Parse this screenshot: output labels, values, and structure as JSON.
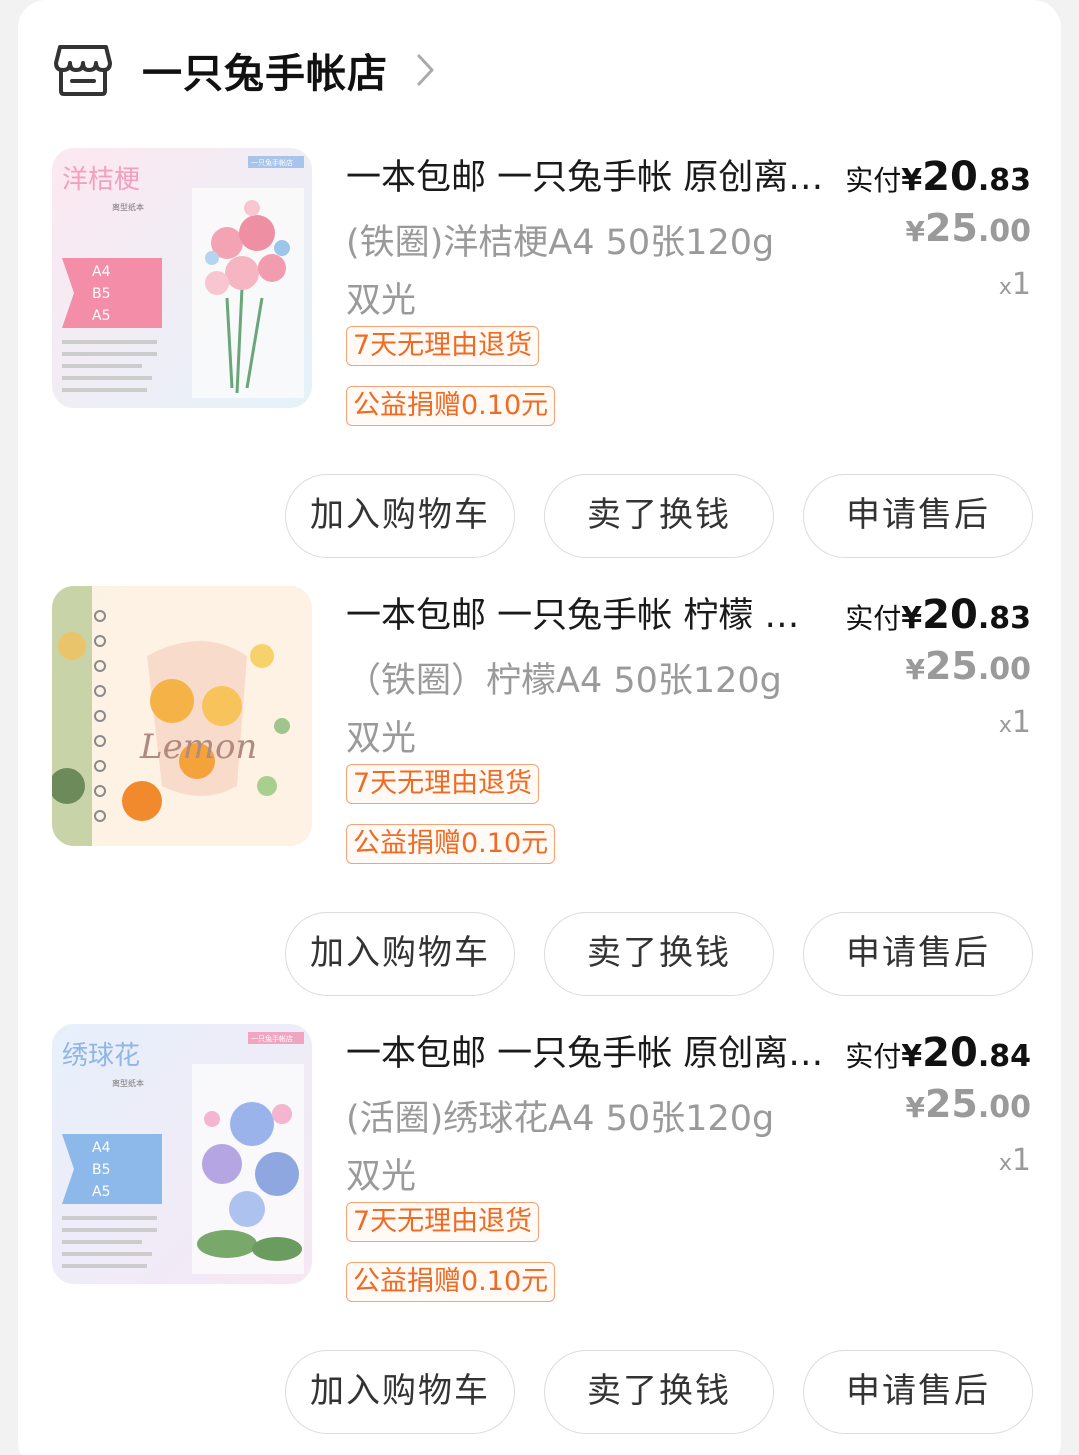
{
  "shop": {
    "name": "一只兔手帐店",
    "icon": "store-icon",
    "chevron": "chevron-right-icon"
  },
  "items": [
    {
      "title": "一本包邮 一只兔手帐 原创离型纸本 洋桔梗",
      "sku": "(铁圈)洋桔梗A4 50张120g 双光",
      "tag_return": "7天无理由退货",
      "tag_charity": "公益捐赠0.10元",
      "paid_label": "实付",
      "paid_currency": "¥",
      "paid_int": "20",
      "paid_dec": ".83",
      "orig_currency": "¥",
      "orig_int": "25",
      "orig_dec": ".00",
      "qty_x": "x",
      "qty_n": "1",
      "thumb_title": "洋桔梗",
      "thumb_sub": "离型纸本",
      "thumb_badge": "一只兔手帐店",
      "buttons": {
        "cart": "加入购物车",
        "sell": "卖了换钱",
        "after": "申请售后"
      }
    },
    {
      "title": "一本包邮 一只兔手帐 柠檬 离型纸本",
      "sku": "（铁圈）柠檬A4 50张120g 双光",
      "tag_return": "7天无理由退货",
      "tag_charity": "公益捐赠0.10元",
      "paid_label": "实付",
      "paid_currency": "¥",
      "paid_int": "20",
      "paid_dec": ".83",
      "orig_currency": "¥",
      "orig_int": "25",
      "orig_dec": ".00",
      "qty_x": "x",
      "qty_n": "1",
      "thumb_title": "Lemon",
      "buttons": {
        "cart": "加入购物车",
        "sell": "卖了换钱",
        "after": "申请售后"
      }
    },
    {
      "title": "一本包邮 一只兔手帐 原创离型纸本 绣球花",
      "sku": "(活圈)绣球花A4 50张120g 双光",
      "tag_return": "7天无理由退货",
      "tag_charity": "公益捐赠0.10元",
      "paid_label": "实付",
      "paid_currency": "¥",
      "paid_int": "20",
      "paid_dec": ".84",
      "orig_currency": "¥",
      "orig_int": "25",
      "orig_dec": ".00",
      "qty_x": "x",
      "qty_n": "1",
      "thumb_title": "绣球花",
      "thumb_sub": "离型纸本",
      "thumb_badge": "一只兔手帐店",
      "buttons": {
        "cart": "加入购物车",
        "sell": "卖了换钱",
        "after": "申请售后"
      }
    }
  ],
  "colors": {
    "accent_tag": "#f06a22",
    "muted": "#9a9a9a"
  }
}
